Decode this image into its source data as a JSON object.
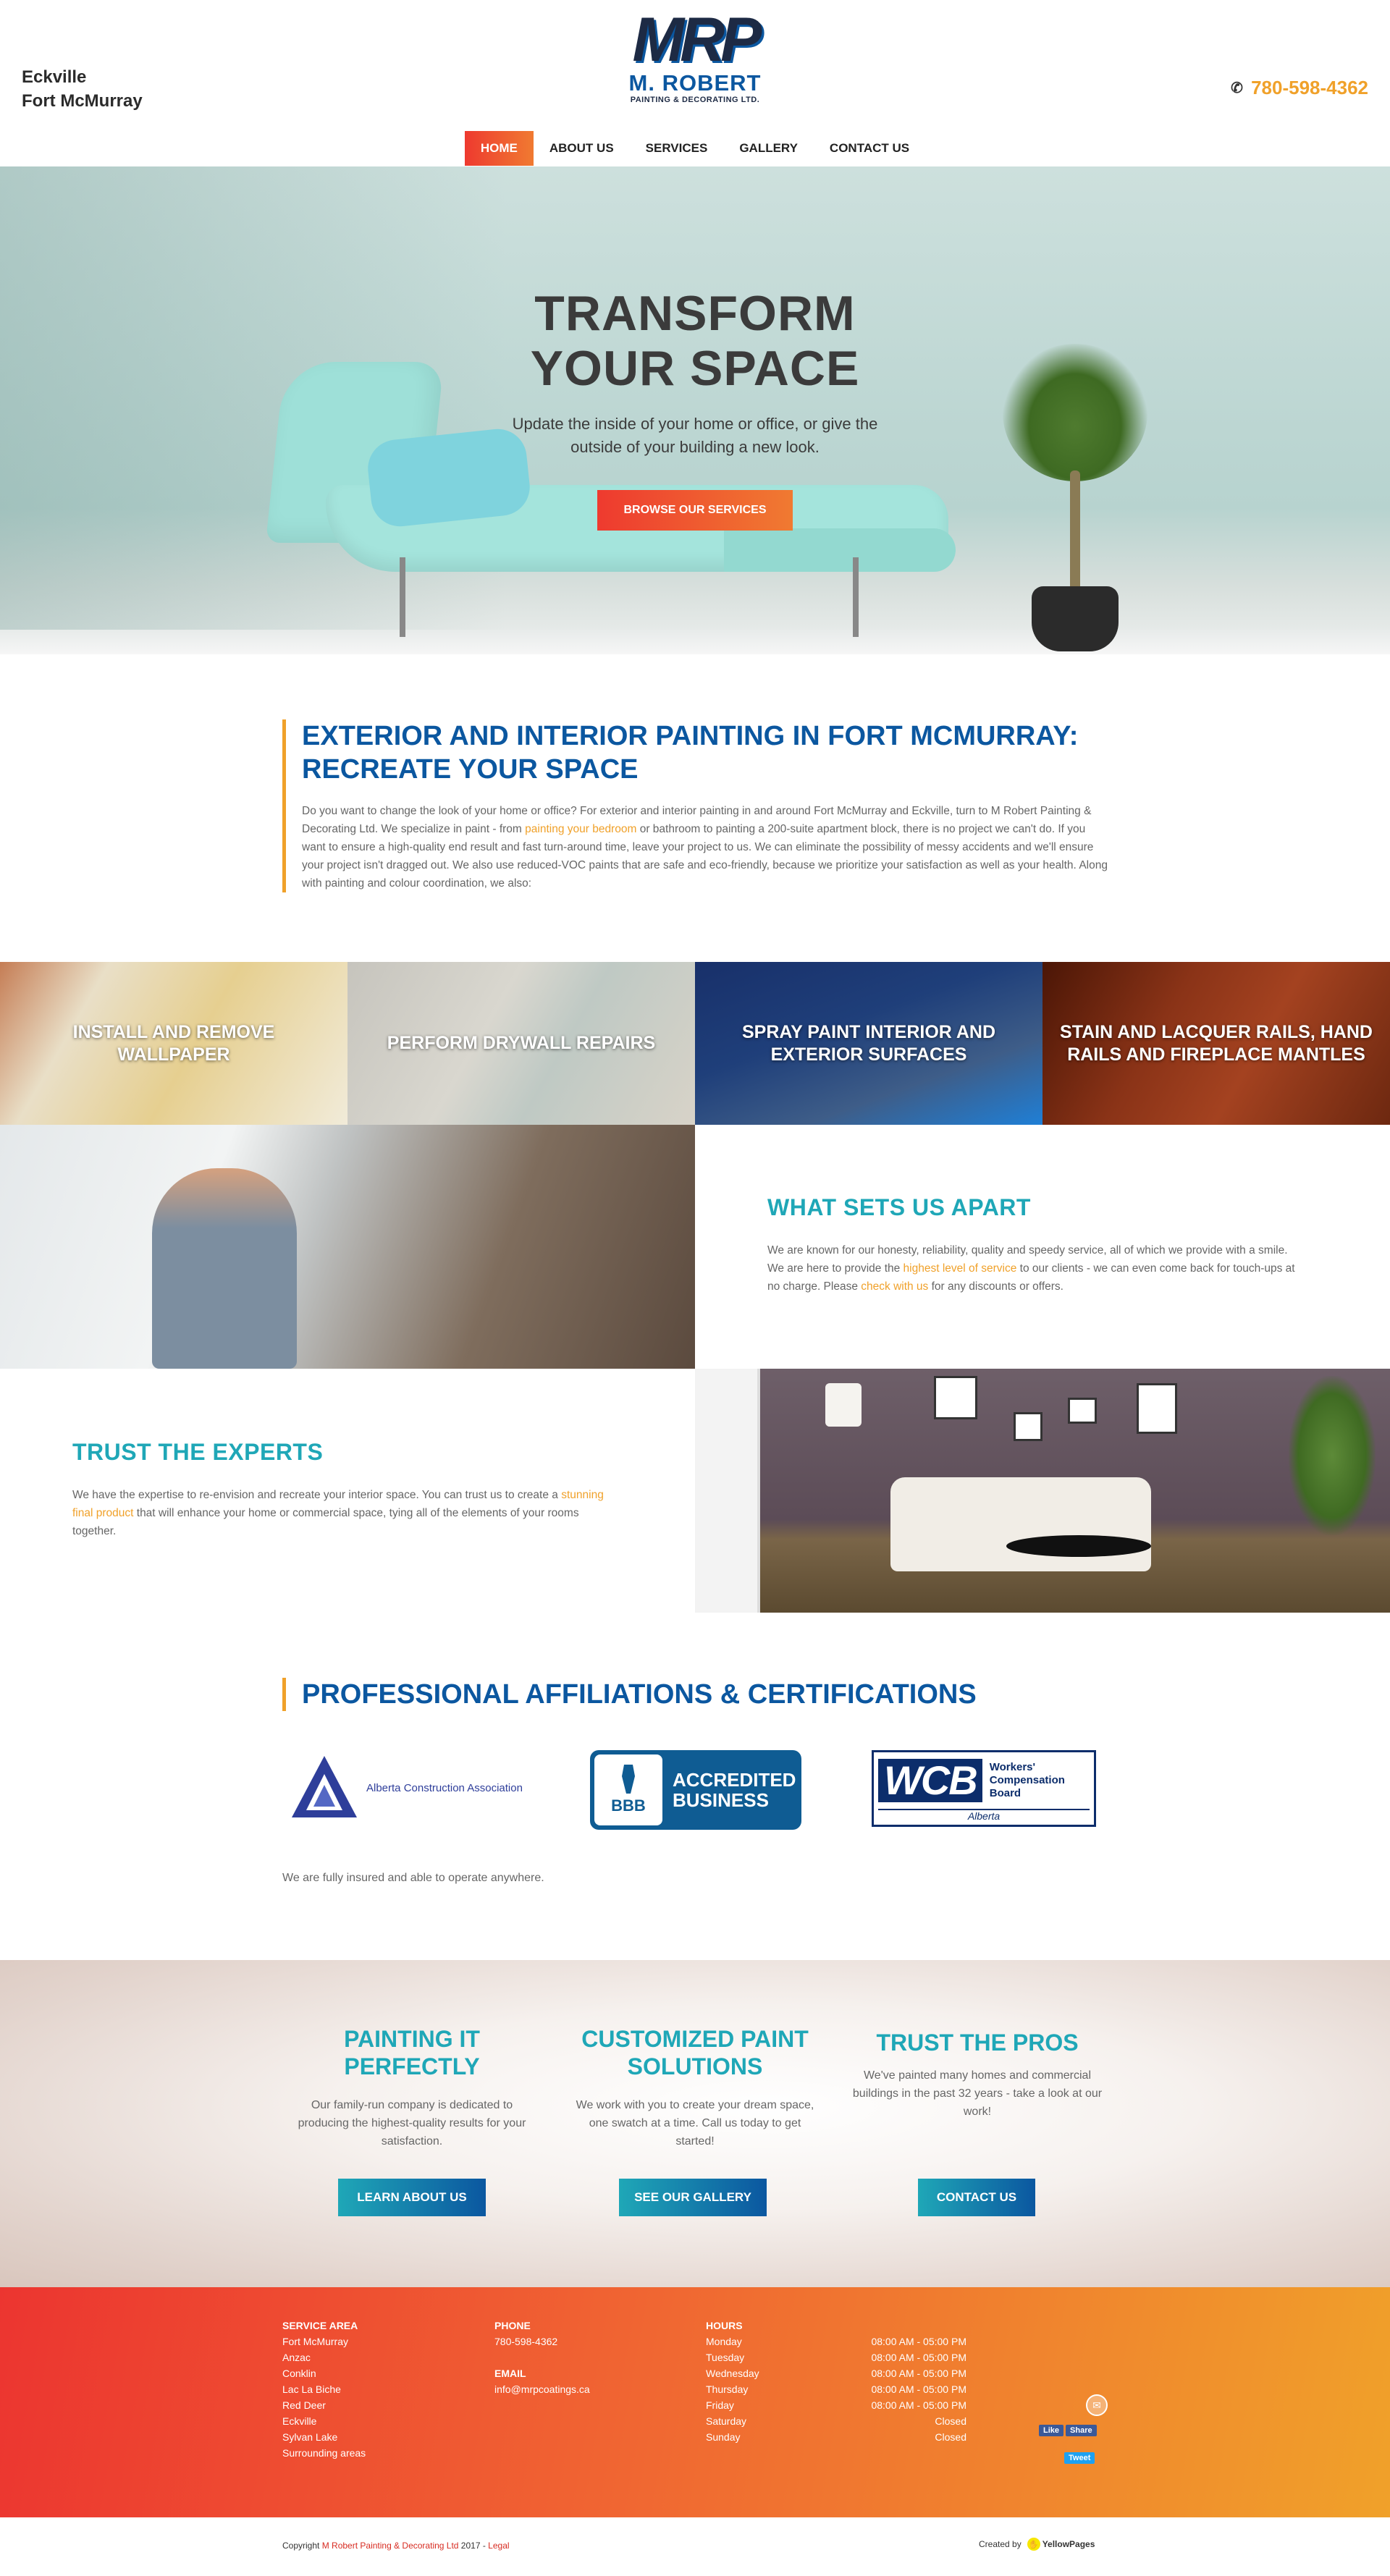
{
  "header": {
    "location_line1": "Eckville",
    "location_line2": "Fort McMurray",
    "logo_mark": "MRP",
    "logo_name": "M. ROBERT",
    "logo_sub": "PAINTING & DECORATING LTD.",
    "phone": "780-598-4362",
    "phone_icon": "phone-icon"
  },
  "nav": {
    "items": [
      {
        "label": "HOME",
        "active": true
      },
      {
        "label": "ABOUT US"
      },
      {
        "label": "SERVICES"
      },
      {
        "label": "GALLERY"
      },
      {
        "label": "CONTACT US"
      }
    ]
  },
  "hero": {
    "title_line1": "TRANSFORM",
    "title_line2": "YOUR SPACE",
    "text": "Update the inside of your home or office, or give the outside of your building a new look.",
    "button": "BROWSE OUR SERVICES"
  },
  "intro": {
    "title_line1": "EXTERIOR AND INTERIOR PAINTING IN FORT MCMURRAY:",
    "title_line2": "RECREATE YOUR SPACE",
    "text_before_link": "Do you want to change the look of your home or office? For exterior and interior painting in and around Fort McMurray and Eckville, turn to M Robert Painting & Decorating Ltd. We specialize in paint - from ",
    "link": "painting your bedroom",
    "text_after_link": " or bathroom to painting a 200-suite apartment block, there is no project we can't do. If you want to ensure a high-quality end result and fast turn-around time, leave your project to us. We can eliminate the possibility of messy accidents and we'll ensure your project isn't dragged out. We also use reduced-VOC paints that are safe and eco-friendly, because we prioritize your satisfaction as well as your health. Along with painting and colour coordination, we also:"
  },
  "tiles": [
    "INSTALL AND REMOVE WALLPAPER",
    "PERFORM DRYWALL REPAIRS",
    "SPRAY PAINT INTERIOR AND EXTERIOR SURFACES",
    "STAIN AND LACQUER RAILS, HAND RAILS AND FIREPLACE MANTLES"
  ],
  "apart": {
    "title": "WHAT SETS US APART",
    "text1": "We are known for our honesty, reliability, quality and speedy service, all of which we provide with a smile. We are here to provide the ",
    "link1": "highest level of service",
    "text2": " to our clients - we can even come back for touch-ups at no charge. Please ",
    "link2": "check with us",
    "text3": " for any discounts or offers."
  },
  "trust": {
    "title": "TRUST THE EXPERTS",
    "text1": "We have the expertise to re-envision and recreate your interior space. You can trust us to create a ",
    "link": "stunning final product",
    "text2": " that will enhance your home or commercial space, tying all of the elements of your rooms together."
  },
  "affiliations": {
    "title": "PROFESSIONAL AFFILIATIONS & CERTIFICATIONS",
    "aca_name": "Alberta Construction Association",
    "bbb_mark": "BBB",
    "bbb_line1": "ACCREDITED",
    "bbb_line2": "BUSINESS",
    "wcb_mark": "WCB",
    "wcb_line1": "Workers'",
    "wcb_line2": "Compensation",
    "wcb_line3": "Board",
    "wcb_province": "Alberta",
    "insured": "We are fully insured and able to operate anywhere."
  },
  "cta": [
    {
      "title": "PAINTING IT PERFECTLY",
      "text": "Our family-run company is dedicated to producing the highest-quality results for your satisfaction.",
      "button": "LEARN ABOUT US"
    },
    {
      "title": "CUSTOMIZED PAINT SOLUTIONS",
      "text": "We work with you to create your dream space, one swatch at a time. Call us today to get started!",
      "button": "SEE OUR GALLERY"
    },
    {
      "title": "TRUST THE PROS",
      "text": "We've painted many homes and commercial buildings in the past 32 years - take a look at our work!",
      "button": "CONTACT US"
    }
  ],
  "footer": {
    "service_head": "SERVICE AREA",
    "service_areas": [
      "Fort McMurray",
      "Anzac",
      "Conklin",
      "Lac La Biche",
      "Red Deer",
      "Eckville",
      "Sylvan Lake",
      "Surrounding areas"
    ],
    "phone_head": "PHONE",
    "phone": "780-598-4362",
    "email_head": "EMAIL",
    "email": "info@mrpcoatings.ca",
    "hours_head": "HOURS",
    "hours": [
      {
        "day": "Monday",
        "time": "08:00 AM - 05:00 PM"
      },
      {
        "day": "Tuesday",
        "time": "08:00 AM - 05:00 PM"
      },
      {
        "day": "Wednesday",
        "time": "08:00 AM - 05:00 PM"
      },
      {
        "day": "Thursday",
        "time": "08:00 AM - 05:00 PM"
      },
      {
        "day": "Friday",
        "time": "08:00 AM - 05:00 PM"
      },
      {
        "day": "Saturday",
        "time": "Closed"
      },
      {
        "day": "Sunday",
        "time": "Closed"
      }
    ],
    "fb_like": "Like",
    "fb_share": "Share",
    "tweet": "Tweet",
    "mail_icon": "mail-icon"
  },
  "bottom": {
    "copy_prefix": "Copyright ",
    "company": "M Robert Painting & Decorating Ltd",
    "year": " 2017 - ",
    "legal": "Legal",
    "created_by": "Created by",
    "yp_name": "YellowPages"
  },
  "colors": {
    "brand_blue": "#0b57a0",
    "teal": "#1fa7b7",
    "orange": "#f0a12a",
    "red": "#ee3a2f"
  }
}
